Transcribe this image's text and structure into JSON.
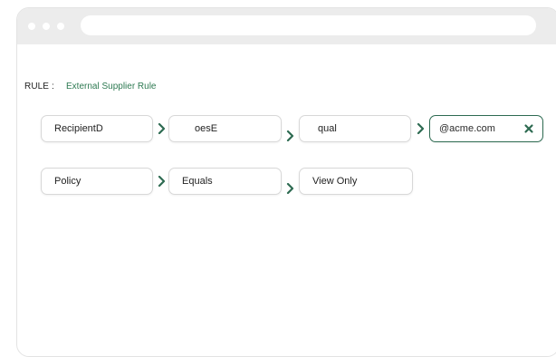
{
  "rule": {
    "label": "RULE :",
    "name": "External Supplier Rule"
  },
  "row1": {
    "field1": "RecipientD",
    "field2": "oesE",
    "field3": "qual",
    "field4": "@acme.com"
  },
  "row2": {
    "field1": "Policy",
    "field2": "Equals",
    "field3": "View Only"
  },
  "colors": {
    "accent": "#2e6b52",
    "rule_text": "#2e7a52"
  }
}
